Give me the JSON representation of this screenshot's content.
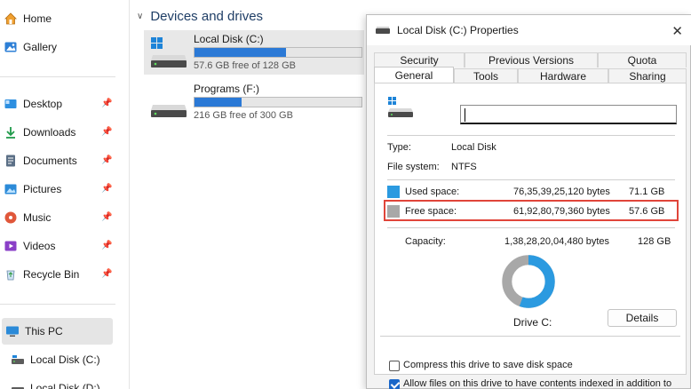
{
  "sidebar": {
    "items": [
      {
        "label": "Home",
        "icon": "home-icon"
      },
      {
        "label": "Gallery",
        "icon": "gallery-icon"
      },
      {
        "label": "Desktop",
        "icon": "desktop-icon",
        "pinned": true
      },
      {
        "label": "Downloads",
        "icon": "download-icon",
        "pinned": true
      },
      {
        "label": "Documents",
        "icon": "document-icon",
        "pinned": true
      },
      {
        "label": "Pictures",
        "icon": "pictures-icon",
        "pinned": true
      },
      {
        "label": "Music",
        "icon": "music-icon",
        "pinned": true
      },
      {
        "label": "Videos",
        "icon": "videos-icon",
        "pinned": true
      },
      {
        "label": "Recycle Bin",
        "icon": "recycle-bin-icon",
        "pinned": true
      },
      {
        "label": "This PC",
        "icon": "this-pc-icon",
        "selected": true
      },
      {
        "label": "Local Disk (C:)",
        "icon": "drive-icon"
      },
      {
        "label": "Local Disk (D:)",
        "icon": "drive-icon"
      }
    ]
  },
  "main": {
    "section_title": "Devices and drives",
    "drives": [
      {
        "name": "Local Disk (C:)",
        "free_text": "57.6 GB free of 128 GB",
        "used_fraction": 0.55,
        "selected": true
      },
      {
        "name": "Programs (F:)",
        "free_text": "216 GB free of 300 GB",
        "used_fraction": 0.28,
        "selected": false
      }
    ]
  },
  "dialog": {
    "title": "Local Disk (C:) Properties",
    "tabs_row1": [
      "Security",
      "Previous Versions",
      "Quota"
    ],
    "tabs_row2": [
      "General",
      "Tools",
      "Hardware",
      "Sharing"
    ],
    "active_tab": "General",
    "name_value": "",
    "type_label": "Type:",
    "type_value": "Local Disk",
    "fs_label": "File system:",
    "fs_value": "NTFS",
    "used_label": "Used space:",
    "used_bytes": "76,35,39,25,120 bytes",
    "used_gb": "71.1 GB",
    "free_label": "Free space:",
    "free_bytes": "61,92,80,79,360 bytes",
    "free_gb": "57.6 GB",
    "capacity_label": "Capacity:",
    "capacity_bytes": "1,38,28,20,04,480 bytes",
    "capacity_gb": "128 GB",
    "drive_label": "Drive C:",
    "details_button": "Details",
    "compress_label": "Compress this drive to save disk space",
    "compress_checked": false,
    "index_label": "Allow files on this drive to have contents indexed in addition to",
    "index_checked": true,
    "used_fraction": 0.555,
    "colors": {
      "used": "#2b9ae0",
      "free": "#a8a8a8",
      "highlight": "#e0453a"
    }
  }
}
